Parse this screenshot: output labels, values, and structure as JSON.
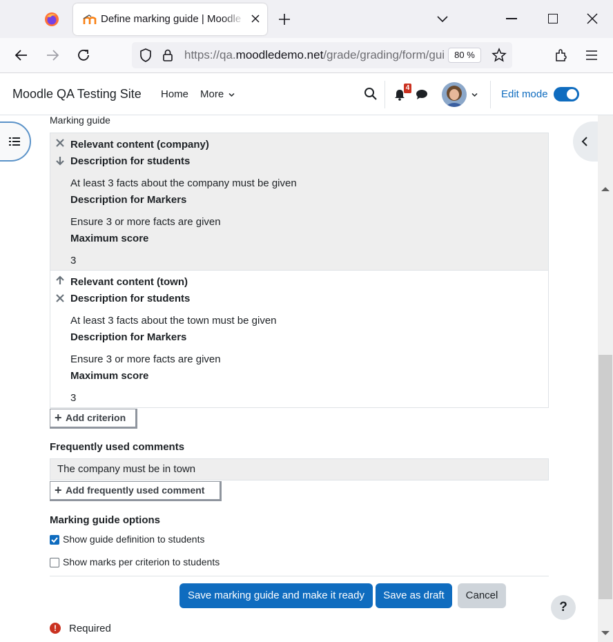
{
  "browser": {
    "tab_title": "Define marking guide | Moodle QA Testing Site",
    "url_prefix": "https://qa.",
    "url_domain": "moodledemo.net",
    "url_path": "/grade/grading/form/guide/edit.php",
    "zoom": "80 %"
  },
  "header": {
    "site_name": "Moodle QA Testing Site",
    "nav": {
      "home": "Home",
      "more": "More"
    },
    "notification_count": "4",
    "edit_mode_label": "Edit mode",
    "edit_mode_on": true
  },
  "guide": {
    "section_label": "Marking guide",
    "criteria": [
      {
        "name": "Relevant content (company)",
        "students_heading": "Description for students",
        "students_text": "At least 3 facts about the company must be given",
        "markers_heading": "Description for Markers",
        "markers_text": "Ensure 3 or more facts are given",
        "maxscore_heading": "Maximum score",
        "maxscore": "3"
      },
      {
        "name": "Relevant content (town)",
        "students_heading": "Description for students",
        "students_text": "At least 3 facts about the town must be given",
        "markers_heading": "Description for Markers",
        "markers_text": "Ensure 3 or more facts are given",
        "maxscore_heading": "Maximum score",
        "maxscore": "3"
      }
    ],
    "add_criterion": "Add criterion"
  },
  "comments": {
    "heading": "Frequently used comments",
    "items": [
      "The company must be in town"
    ],
    "add_label": "Add frequently used comment"
  },
  "options": {
    "heading": "Marking guide options",
    "show_definition": {
      "label": "Show guide definition to students",
      "checked": true
    },
    "show_marks": {
      "label": "Show marks per criterion to students",
      "checked": false
    }
  },
  "actions": {
    "save_ready": "Save marking guide and make it ready",
    "save_draft": "Save as draft",
    "cancel": "Cancel"
  },
  "help": "?",
  "required": {
    "icon": "!",
    "label": "Required"
  },
  "colors": {
    "primary": "#0f6cbf",
    "danger": "#ca3120",
    "criterion_bg": "#eeeeee"
  }
}
